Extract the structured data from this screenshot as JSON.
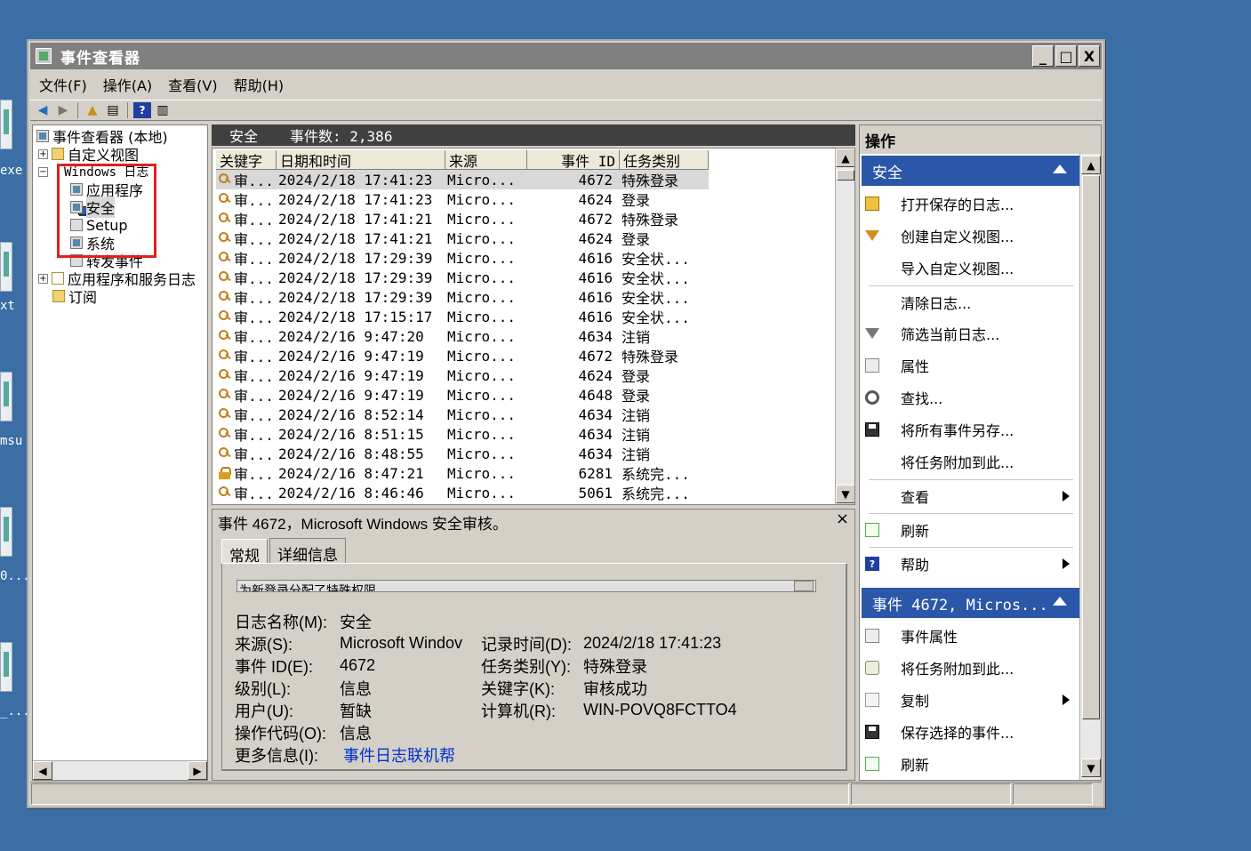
{
  "desktop": {
    "labels": [
      "exe",
      "xt",
      "msu",
      "0...",
      "_..."
    ]
  },
  "window": {
    "title": "事件查看器",
    "controls": {
      "minimize": "_",
      "maximize": "□",
      "close": "X"
    }
  },
  "menu": [
    "文件(F)",
    "操作(A)",
    "查看(V)",
    "帮助(H)"
  ],
  "tree": {
    "root": "事件查看器 (本地)",
    "custom_views": "自定义视图",
    "windows_logs": "Windows 日志",
    "children": [
      "应用程序",
      "安全",
      "Setup",
      "系统",
      "转发事件"
    ],
    "app_services": "应用程序和服务日志",
    "subscriptions": "订阅"
  },
  "center": {
    "title": "安全",
    "event_count": "事件数: 2,386",
    "columns": [
      "关键字",
      "日期和时间",
      "来源",
      "事件 ID",
      "任务类别"
    ],
    "rows": [
      {
        "icon": "key",
        "kw": "审...",
        "dt": "2024/2/18 17:41:23",
        "src": "Micro...",
        "id": "4672",
        "cat": "特殊登录"
      },
      {
        "icon": "key",
        "kw": "审...",
        "dt": "2024/2/18 17:41:23",
        "src": "Micro...",
        "id": "4624",
        "cat": "登录"
      },
      {
        "icon": "key",
        "kw": "审...",
        "dt": "2024/2/18 17:41:21",
        "src": "Micro...",
        "id": "4672",
        "cat": "特殊登录"
      },
      {
        "icon": "key",
        "kw": "审...",
        "dt": "2024/2/18 17:41:21",
        "src": "Micro...",
        "id": "4624",
        "cat": "登录"
      },
      {
        "icon": "key",
        "kw": "审...",
        "dt": "2024/2/18 17:29:39",
        "src": "Micro...",
        "id": "4616",
        "cat": "安全状..."
      },
      {
        "icon": "key",
        "kw": "审...",
        "dt": "2024/2/18 17:29:39",
        "src": "Micro...",
        "id": "4616",
        "cat": "安全状..."
      },
      {
        "icon": "key",
        "kw": "审...",
        "dt": "2024/2/18 17:29:39",
        "src": "Micro...",
        "id": "4616",
        "cat": "安全状..."
      },
      {
        "icon": "key",
        "kw": "审...",
        "dt": "2024/2/18 17:15:17",
        "src": "Micro...",
        "id": "4616",
        "cat": "安全状..."
      },
      {
        "icon": "key",
        "kw": "审...",
        "dt": "2024/2/16 9:47:20",
        "src": "Micro...",
        "id": "4634",
        "cat": "注销"
      },
      {
        "icon": "key",
        "kw": "审...",
        "dt": "2024/2/16 9:47:19",
        "src": "Micro...",
        "id": "4672",
        "cat": "特殊登录"
      },
      {
        "icon": "key",
        "kw": "审...",
        "dt": "2024/2/16 9:47:19",
        "src": "Micro...",
        "id": "4624",
        "cat": "登录"
      },
      {
        "icon": "key",
        "kw": "审...",
        "dt": "2024/2/16 9:47:19",
        "src": "Micro...",
        "id": "4648",
        "cat": "登录"
      },
      {
        "icon": "key",
        "kw": "审...",
        "dt": "2024/2/16 8:52:14",
        "src": "Micro...",
        "id": "4634",
        "cat": "注销"
      },
      {
        "icon": "key",
        "kw": "审...",
        "dt": "2024/2/16 8:51:15",
        "src": "Micro...",
        "id": "4634",
        "cat": "注销"
      },
      {
        "icon": "key",
        "kw": "审...",
        "dt": "2024/2/16 8:48:55",
        "src": "Micro...",
        "id": "4634",
        "cat": "注销"
      },
      {
        "icon": "lock",
        "kw": "审...",
        "dt": "2024/2/16 8:47:21",
        "src": "Micro...",
        "id": "6281",
        "cat": "系统完..."
      },
      {
        "icon": "key",
        "kw": "审...",
        "dt": "2024/2/16 8:46:46",
        "src": "Micro...",
        "id": "5061",
        "cat": "系统完..."
      }
    ]
  },
  "detail": {
    "header": "事件 4672，Microsoft Windows 安全审核。",
    "close": "×",
    "tabs": [
      "常规",
      "详细信息"
    ],
    "description": "为新登录分配了特殊权限。",
    "fields": {
      "log_name_label": "日志名称(M):",
      "log_name": "安全",
      "source_label": "来源(S):",
      "source": "Microsoft Windov",
      "logged_label": "记录时间(D):",
      "logged": "2024/2/18 17:41:23",
      "event_id_label": "事件 ID(E):",
      "event_id": "4672",
      "task_label": "任务类别(Y):",
      "task": "特殊登录",
      "level_label": "级别(L):",
      "level": "信息",
      "keywords_label": "关键字(K):",
      "keywords": "审核成功",
      "user_label": "用户(U):",
      "user": "暂缺",
      "computer_label": "计算机(R):",
      "computer": "WIN-POVQ8FCTTO4",
      "opcode_label": "操作代码(O):",
      "opcode": "信息",
      "more_label": "更多信息(I):",
      "more_link": "事件日志联机帮"
    }
  },
  "actions": {
    "header": "操作",
    "section1": "安全",
    "items1": [
      "打开保存的日志...",
      "创建自定义视图...",
      "导入自定义视图...",
      "清除日志...",
      "筛选当前日志...",
      "属性",
      "查找...",
      "将所有事件另存...",
      "将任务附加到此...",
      "查看",
      "刷新",
      "帮助"
    ],
    "section2": "事件 4672, Micros...",
    "items2": [
      "事件属性",
      "将任务附加到此...",
      "复制",
      "保存选择的事件...",
      "刷新"
    ]
  }
}
